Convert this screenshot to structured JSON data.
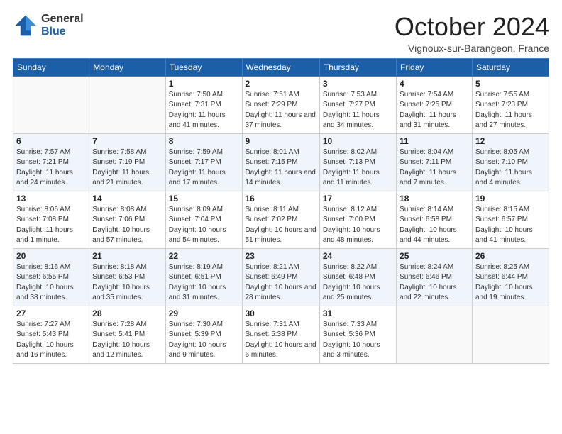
{
  "logo": {
    "general": "General",
    "blue": "Blue"
  },
  "header": {
    "title": "October 2024",
    "subtitle": "Vignoux-sur-Barangeon, France"
  },
  "days_of_week": [
    "Sunday",
    "Monday",
    "Tuesday",
    "Wednesday",
    "Thursday",
    "Friday",
    "Saturday"
  ],
  "weeks": [
    [
      {
        "day": "",
        "info": ""
      },
      {
        "day": "",
        "info": ""
      },
      {
        "day": "1",
        "info": "Sunrise: 7:50 AM\nSunset: 7:31 PM\nDaylight: 11 hours and 41 minutes."
      },
      {
        "day": "2",
        "info": "Sunrise: 7:51 AM\nSunset: 7:29 PM\nDaylight: 11 hours and 37 minutes."
      },
      {
        "day": "3",
        "info": "Sunrise: 7:53 AM\nSunset: 7:27 PM\nDaylight: 11 hours and 34 minutes."
      },
      {
        "day": "4",
        "info": "Sunrise: 7:54 AM\nSunset: 7:25 PM\nDaylight: 11 hours and 31 minutes."
      },
      {
        "day": "5",
        "info": "Sunrise: 7:55 AM\nSunset: 7:23 PM\nDaylight: 11 hours and 27 minutes."
      }
    ],
    [
      {
        "day": "6",
        "info": "Sunrise: 7:57 AM\nSunset: 7:21 PM\nDaylight: 11 hours and 24 minutes."
      },
      {
        "day": "7",
        "info": "Sunrise: 7:58 AM\nSunset: 7:19 PM\nDaylight: 11 hours and 21 minutes."
      },
      {
        "day": "8",
        "info": "Sunrise: 7:59 AM\nSunset: 7:17 PM\nDaylight: 11 hours and 17 minutes."
      },
      {
        "day": "9",
        "info": "Sunrise: 8:01 AM\nSunset: 7:15 PM\nDaylight: 11 hours and 14 minutes."
      },
      {
        "day": "10",
        "info": "Sunrise: 8:02 AM\nSunset: 7:13 PM\nDaylight: 11 hours and 11 minutes."
      },
      {
        "day": "11",
        "info": "Sunrise: 8:04 AM\nSunset: 7:11 PM\nDaylight: 11 hours and 7 minutes."
      },
      {
        "day": "12",
        "info": "Sunrise: 8:05 AM\nSunset: 7:10 PM\nDaylight: 11 hours and 4 minutes."
      }
    ],
    [
      {
        "day": "13",
        "info": "Sunrise: 8:06 AM\nSunset: 7:08 PM\nDaylight: 11 hours and 1 minute."
      },
      {
        "day": "14",
        "info": "Sunrise: 8:08 AM\nSunset: 7:06 PM\nDaylight: 10 hours and 57 minutes."
      },
      {
        "day": "15",
        "info": "Sunrise: 8:09 AM\nSunset: 7:04 PM\nDaylight: 10 hours and 54 minutes."
      },
      {
        "day": "16",
        "info": "Sunrise: 8:11 AM\nSunset: 7:02 PM\nDaylight: 10 hours and 51 minutes."
      },
      {
        "day": "17",
        "info": "Sunrise: 8:12 AM\nSunset: 7:00 PM\nDaylight: 10 hours and 48 minutes."
      },
      {
        "day": "18",
        "info": "Sunrise: 8:14 AM\nSunset: 6:58 PM\nDaylight: 10 hours and 44 minutes."
      },
      {
        "day": "19",
        "info": "Sunrise: 8:15 AM\nSunset: 6:57 PM\nDaylight: 10 hours and 41 minutes."
      }
    ],
    [
      {
        "day": "20",
        "info": "Sunrise: 8:16 AM\nSunset: 6:55 PM\nDaylight: 10 hours and 38 minutes."
      },
      {
        "day": "21",
        "info": "Sunrise: 8:18 AM\nSunset: 6:53 PM\nDaylight: 10 hours and 35 minutes."
      },
      {
        "day": "22",
        "info": "Sunrise: 8:19 AM\nSunset: 6:51 PM\nDaylight: 10 hours and 31 minutes."
      },
      {
        "day": "23",
        "info": "Sunrise: 8:21 AM\nSunset: 6:49 PM\nDaylight: 10 hours and 28 minutes."
      },
      {
        "day": "24",
        "info": "Sunrise: 8:22 AM\nSunset: 6:48 PM\nDaylight: 10 hours and 25 minutes."
      },
      {
        "day": "25",
        "info": "Sunrise: 8:24 AM\nSunset: 6:46 PM\nDaylight: 10 hours and 22 minutes."
      },
      {
        "day": "26",
        "info": "Sunrise: 8:25 AM\nSunset: 6:44 PM\nDaylight: 10 hours and 19 minutes."
      }
    ],
    [
      {
        "day": "27",
        "info": "Sunrise: 7:27 AM\nSunset: 5:43 PM\nDaylight: 10 hours and 16 minutes."
      },
      {
        "day": "28",
        "info": "Sunrise: 7:28 AM\nSunset: 5:41 PM\nDaylight: 10 hours and 12 minutes."
      },
      {
        "day": "29",
        "info": "Sunrise: 7:30 AM\nSunset: 5:39 PM\nDaylight: 10 hours and 9 minutes."
      },
      {
        "day": "30",
        "info": "Sunrise: 7:31 AM\nSunset: 5:38 PM\nDaylight: 10 hours and 6 minutes."
      },
      {
        "day": "31",
        "info": "Sunrise: 7:33 AM\nSunset: 5:36 PM\nDaylight: 10 hours and 3 minutes."
      },
      {
        "day": "",
        "info": ""
      },
      {
        "day": "",
        "info": ""
      }
    ]
  ]
}
